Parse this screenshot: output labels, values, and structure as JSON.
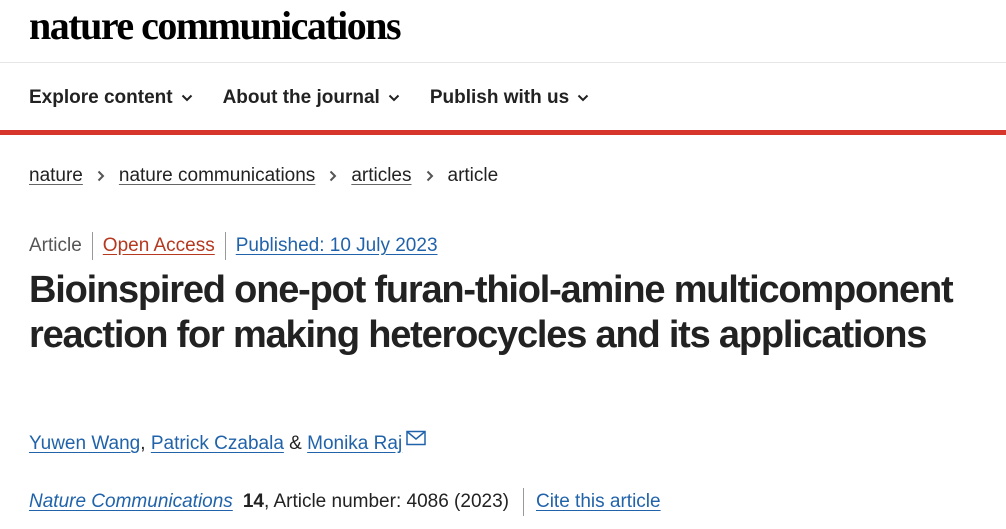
{
  "header": {
    "logo_text": "nature communications"
  },
  "nav": {
    "items": [
      {
        "label": "Explore content"
      },
      {
        "label": "About the journal"
      },
      {
        "label": "Publish with us"
      }
    ],
    "accent_color": "#d6352b"
  },
  "breadcrumbs": {
    "items": [
      {
        "label": "nature"
      },
      {
        "label": "nature communications"
      },
      {
        "label": "articles"
      },
      {
        "label": "article"
      }
    ]
  },
  "article": {
    "type": "Article",
    "access": "Open Access",
    "published": "Published: 10 July 2023",
    "title": "Bioinspired one-pot furan-thiol-amine multicomponent reaction for making heterocycles and its applications",
    "authors": {
      "a1": "Yuwen Wang",
      "sep1": ", ",
      "a2": "Patrick Czabala",
      "sep2": " & ",
      "a3": "Monika Raj",
      "contact_icon": "envelope-icon"
    },
    "citation": {
      "journal": "Nature Communications",
      "volume": "14",
      "article_number": ", Article number: 4086 (2023)",
      "cite_label": "Cite this article"
    }
  }
}
